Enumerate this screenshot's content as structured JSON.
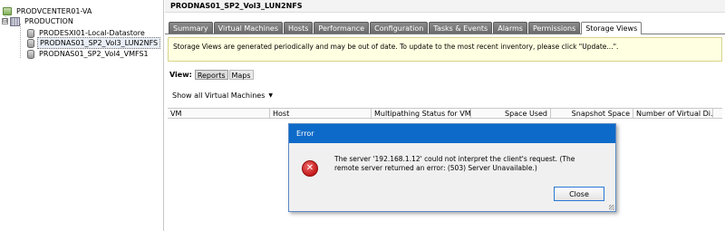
{
  "tree": {
    "root": {
      "label": "PRODVCENTER01-VA",
      "icon": "vcenter-icon"
    },
    "datacenter": {
      "label": "PRODUCTION",
      "icon": "datacenter-icon",
      "toggle": "⊟"
    },
    "datastores": [
      {
        "label": "PRODESXI01-Local-Datastore",
        "icon": "datastore-icon"
      },
      {
        "label": "PRODNAS01_SP2_Vol3_LUN2NFS",
        "icon": "datastore-icon",
        "selected": true
      },
      {
        "label": "PRODNAS01_SP2_Vol4_VMFS1",
        "icon": "datastore-icon"
      }
    ]
  },
  "main": {
    "title": "PRODNAS01_SP2_Vol3_LUN2NFS",
    "tabs": [
      {
        "label": "Summary"
      },
      {
        "label": "Virtual Machines"
      },
      {
        "label": "Hosts"
      },
      {
        "label": "Performance"
      },
      {
        "label": "Configuration"
      },
      {
        "label": "Tasks & Events"
      },
      {
        "label": "Alarms"
      },
      {
        "label": "Permissions"
      },
      {
        "label": "Storage Views",
        "active": true
      }
    ],
    "banner": "Storage Views are generated periodically and may be out of date. To update to the most recent inventory, please click \"Update...\".",
    "view_label": "View:",
    "view_buttons": [
      "Reports",
      "Maps"
    ],
    "filter_label": "Show all Virtual Machines",
    "columns": [
      "VM",
      "Host",
      "Multipathing Status for VM",
      "Space Used",
      "Snapshot Space",
      "Number of Virtual Di..."
    ]
  },
  "dialog": {
    "title": "Error",
    "icon": "error-icon",
    "message": "The server '192.168.1.12' could not interpret the client's request. (The remote server returned an error: (503) Server Unavailable.)",
    "close_label": "Close"
  },
  "colors": {
    "dialog_title_bg": "#0e6ac8",
    "banner_bg": "#ffffe1",
    "tab_bg": "#7a7a7a"
  }
}
